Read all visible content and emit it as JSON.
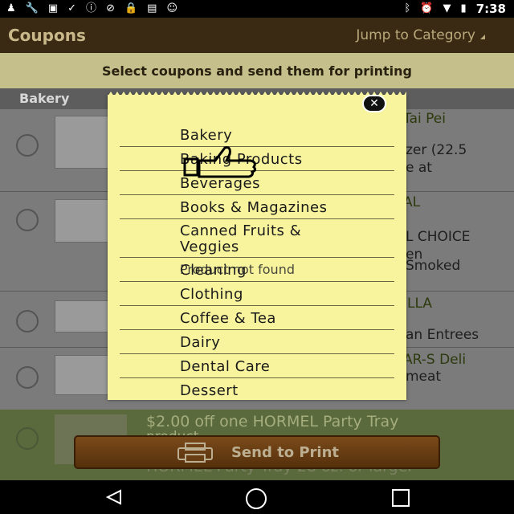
{
  "status_bar": {
    "time": "7:38",
    "left_icons": [
      "person-icon",
      "wrench-icon",
      "image-icon",
      "tiktok-like-icon",
      "info-icon",
      "no-signal-icon",
      "lock-icon",
      "photo-icon",
      "android-icon"
    ],
    "right_icons": [
      "bluetooth-icon",
      "alarm-icon",
      "wifi-icon",
      "battery-icon"
    ]
  },
  "action_bar": {
    "title": "Coupons",
    "jump_label": "Jump to Category"
  },
  "banner": {
    "text": "Select coupons and send them for printing"
  },
  "list": {
    "section_header": "Bakery",
    "rows": [
      {
        "title": "Tai Pei",
        "desc": [
          "zer (22.5",
          "e at"
        ]
      },
      {
        "title": "AL",
        "desc": [
          "L CHOICE",
          "en",
          "Smoked"
        ]
      },
      {
        "title": "ILLA",
        "desc": [
          "an Entrees"
        ]
      },
      {
        "title": "AR-S Deli",
        "desc": [
          "meat"
        ]
      }
    ],
    "bottom_row": {
      "title": "$2.00 off one HORMEL Party Tray",
      "subtitle": "product",
      "desc": "HORMEL Party Tray 28 oz. or larger"
    }
  },
  "send_button": {
    "label": "Send to Print"
  },
  "popup": {
    "close_label": "✕",
    "categories": [
      "Bakery",
      "Baking Products",
      "Beverages",
      "Books & Magazines",
      "Canned Fruits & Veggies",
      "Cleaning",
      "Clothing",
      "Coffee & Tea",
      "Dairy",
      "Dental Care",
      "Dessert"
    ],
    "toast": "Product not found"
  },
  "colors": {
    "action_bar": "#3a2a14",
    "banner": "#c5bf8c",
    "popup": "#f8f49e",
    "button": "#6a3e14"
  }
}
